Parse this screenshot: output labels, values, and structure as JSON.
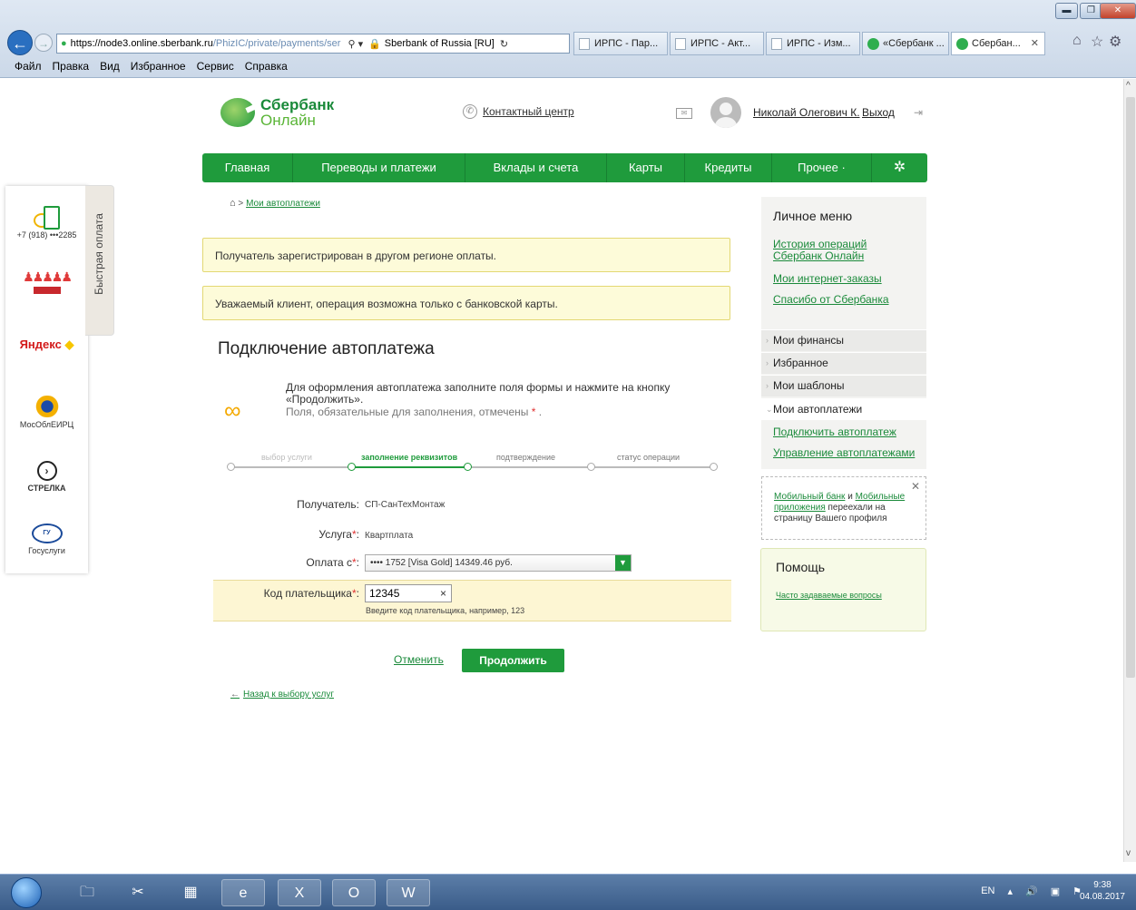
{
  "browser": {
    "url_domain": "https://node3.online.sberbank.ru",
    "url_rest": "/PhizIC/private/payments/ser",
    "site_id": "Sberbank of Russia [RU]",
    "tabs": [
      {
        "label": "ИРПС - Пар...",
        "kind": "doc"
      },
      {
        "label": "ИРПС - Акт...",
        "kind": "doc"
      },
      {
        "label": "ИРПС - Изм...",
        "kind": "doc"
      },
      {
        "label": "«Сбербанк ...",
        "kind": "sber"
      },
      {
        "label": "Сбербан...",
        "kind": "sber",
        "active": true
      }
    ],
    "menu": [
      "Файл",
      "Правка",
      "Вид",
      "Избранное",
      "Сервис",
      "Справка"
    ]
  },
  "header": {
    "logo_line1": "Сбербанк",
    "logo_line2": "Онлайн",
    "contact_center": "Контактный центр",
    "user_name": "Николай Олегович К.",
    "logout": "Выход"
  },
  "main_nav": [
    "Главная",
    "Переводы и платежи",
    "Вклады и счета",
    "Карты",
    "Кредиты",
    "Прочее ·"
  ],
  "quick_pay": {
    "tab_label": "Быстрая оплата",
    "phone": "+7 (918) •••2285",
    "mos": "МосОблЕИРЦ",
    "strelka": "СТРЕЛКА",
    "gos": "Госуслуги",
    "yandex": "Яндекс"
  },
  "breadcrumb": "Мои автоплатежи",
  "alerts": [
    "Получатель зарегистрирован в другом регионе оплаты.",
    "Уважаемый клиент, операция возможна только с банковской карты."
  ],
  "page_title": "Подключение автоплатежа",
  "intro": {
    "line1": "Для оформления автоплатежа заполните поля формы и нажмите на кнопку «Продолжить».",
    "line2": "Поля, обязательные для заполнения, отмечены",
    "star": "*"
  },
  "steps": [
    {
      "label": "выбор услуги",
      "state": "done"
    },
    {
      "label": "заполнение реквизитов",
      "state": "current"
    },
    {
      "label": "подтверждение",
      "state": "next"
    },
    {
      "label": "статус операции",
      "state": "next"
    }
  ],
  "form": {
    "recipient_label": "Получатель:",
    "recipient_value": "СП-СанТехМонтаж",
    "service_label": "Услуга",
    "service_value": "Квартплата",
    "pay_from_label": "Оплата с",
    "pay_from_value": "•••• 1752 [Visa Gold] 14349.46 руб.",
    "payer_code_label": "Код плательщика",
    "payer_code_value": "12345",
    "payer_code_hint": "Введите код плательщика, например, 123",
    "required_mark": "*",
    "colon": ":"
  },
  "actions": {
    "cancel": "Отменить",
    "continue": "Продолжить",
    "back": "Назад к выбору услуг"
  },
  "personal_menu": {
    "title": "Личное меню",
    "links": [
      "История операций Сбербанк Онлайн",
      "Мои интернет-заказы",
      "Спасибо от Сбербанка"
    ],
    "items": [
      "Мои финансы",
      "Избранное",
      "Мои шаблоны",
      "Мои автоплатежи"
    ],
    "sub_links": [
      "Подключить автоплатеж",
      "Управление автоплатежами"
    ]
  },
  "mobile_notice": {
    "link1": "Мобильный банк",
    "and": "и",
    "link2": "Мобильные приложения",
    "rest": "переехали на страницу Вашего профиля"
  },
  "help": {
    "title": "Помощь",
    "faq": "Часто задаваемые вопросы"
  },
  "taskbar": {
    "lang": "EN",
    "time": "9:38",
    "date": "04.08.2017"
  },
  "colors": {
    "brand_green": "#1f9b3c",
    "alert_bg": "#fdfbd9",
    "required_red": "#e03030"
  }
}
